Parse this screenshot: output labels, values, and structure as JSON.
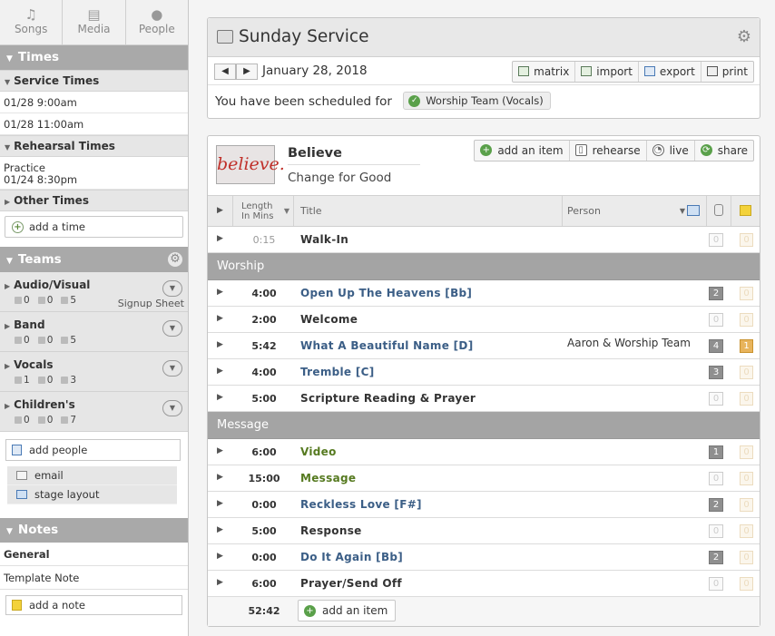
{
  "sidebar": {
    "nav": [
      {
        "label": "Songs",
        "icon": "music-note-icon"
      },
      {
        "label": "Media",
        "icon": "film-icon"
      },
      {
        "label": "People",
        "icon": "person-icon"
      }
    ],
    "times": {
      "heading": "Times",
      "service_heading": "Service Times",
      "service_times": [
        "01/28 9:00am",
        "01/28 11:00am"
      ],
      "rehearsal_heading": "Rehearsal Times",
      "rehearsal": {
        "name": "Practice",
        "time": "01/24 8:30pm"
      },
      "other_heading": "Other Times",
      "add_time": "add a time"
    },
    "teams": {
      "heading": "Teams",
      "signup_sheet": "Signup Sheet",
      "items": [
        {
          "name": "Audio/Visual",
          "confirmed": "0",
          "declined": "0",
          "unconfirmed": "5"
        },
        {
          "name": "Band",
          "confirmed": "0",
          "declined": "0",
          "unconfirmed": "5"
        },
        {
          "name": "Vocals",
          "confirmed": "1",
          "declined": "0",
          "unconfirmed": "3"
        },
        {
          "name": "Children's",
          "confirmed": "0",
          "declined": "0",
          "unconfirmed": "7"
        }
      ],
      "add_people": "add people",
      "email": "email",
      "stage_layout": "stage layout"
    },
    "notes": {
      "heading": "Notes",
      "general": "General",
      "template_note": "Template Note",
      "add_note": "add a note"
    }
  },
  "service": {
    "title": "Sunday Service",
    "date": "January 28, 2018",
    "toolbar": [
      "matrix",
      "import",
      "export",
      "print"
    ],
    "scheduled_text": "You have been scheduled for",
    "scheduled_badge": "Worship Team (Vocals)"
  },
  "plan": {
    "art_text": "believe.",
    "title": "Believe",
    "subtitle": "Change for Good",
    "buttons": [
      "add an item",
      "rehearse",
      "live",
      "share"
    ],
    "columns": {
      "length": "Length",
      "length2": "In Mins",
      "title": "Title",
      "person": "Person"
    },
    "rows": [
      {
        "kind": "item",
        "len": "0:15",
        "dim": true,
        "title": "Walk-In",
        "type": "plain",
        "person": "",
        "c1": "0",
        "c1on": false,
        "c2": "0",
        "c2on": false
      },
      {
        "kind": "header",
        "title": "Worship"
      },
      {
        "kind": "item",
        "len": "4:00",
        "title": "Open Up The Heavens [Bb]",
        "type": "song",
        "person": "",
        "c1": "2",
        "c1on": true,
        "c2": "0",
        "c2on": false
      },
      {
        "kind": "item",
        "len": "2:00",
        "title": "Welcome",
        "type": "plain",
        "person": "",
        "c1": "0",
        "c1on": false,
        "c2": "0",
        "c2on": false
      },
      {
        "kind": "item",
        "len": "5:42",
        "title": "What A Beautiful Name [D]",
        "type": "song",
        "person": "Aaron & Worship Team",
        "c1": "4",
        "c1on": true,
        "c2": "1",
        "c2on": true
      },
      {
        "kind": "item",
        "len": "4:00",
        "title": "Tremble [C]",
        "type": "song",
        "person": "",
        "c1": "3",
        "c1on": true,
        "c2": "0",
        "c2on": false
      },
      {
        "kind": "item",
        "len": "5:00",
        "title": "Scripture Reading & Prayer",
        "type": "plain",
        "person": "",
        "c1": "0",
        "c1on": false,
        "c2": "0",
        "c2on": false
      },
      {
        "kind": "header",
        "title": "Message"
      },
      {
        "kind": "item",
        "len": "6:00",
        "title": "Video",
        "type": "media",
        "person": "",
        "c1": "1",
        "c1on": true,
        "c2": "0",
        "c2on": false
      },
      {
        "kind": "item",
        "len": "15:00",
        "title": "Message",
        "type": "media",
        "person": "",
        "c1": "0",
        "c1on": false,
        "c2": "0",
        "c2on": false
      },
      {
        "kind": "item",
        "len": "0:00",
        "title": "Reckless Love [F#]",
        "type": "song",
        "person": "",
        "c1": "2",
        "c1on": true,
        "c2": "0",
        "c2on": false
      },
      {
        "kind": "item",
        "len": "5:00",
        "title": "Response",
        "type": "plain",
        "person": "",
        "c1": "0",
        "c1on": false,
        "c2": "0",
        "c2on": false
      },
      {
        "kind": "item",
        "len": "0:00",
        "title": "Do It Again [Bb]",
        "type": "song",
        "person": "",
        "c1": "2",
        "c1on": true,
        "c2": "0",
        "c2on": false
      },
      {
        "kind": "item",
        "len": "6:00",
        "title": "Prayer/Send Off",
        "type": "plain",
        "person": "",
        "c1": "0",
        "c1on": false,
        "c2": "0",
        "c2on": false
      }
    ],
    "total": "52:42",
    "add_item": "add an item"
  }
}
